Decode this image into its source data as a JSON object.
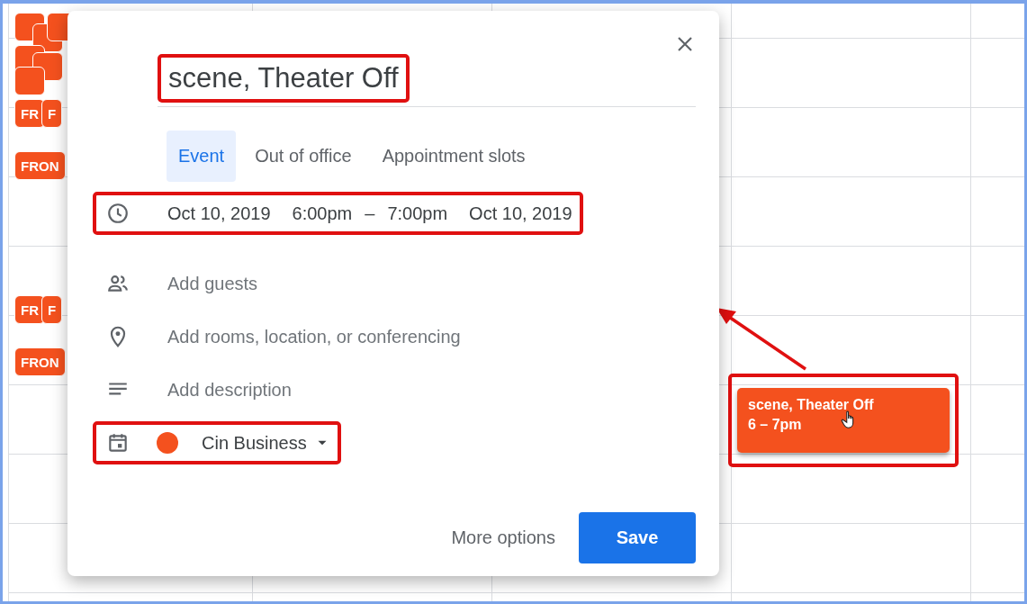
{
  "calendar": {
    "side_chips": [
      {
        "kind": "cluster"
      },
      {
        "kind": "row",
        "labels": [
          "FR",
          "F"
        ]
      },
      {
        "kind": "row",
        "labels": [
          "FRON"
        ]
      },
      {
        "kind": "gap"
      },
      {
        "kind": "row",
        "labels": [
          "FR",
          "F"
        ]
      },
      {
        "kind": "row",
        "labels": [
          "FRON"
        ]
      }
    ],
    "event_chip": {
      "title": "scene, Theater Off",
      "time": "6 – 7pm",
      "color": "#f4511e",
      "highlighted": true
    }
  },
  "dialog": {
    "title": {
      "value": "scene, Theater Off",
      "highlighted": true
    },
    "tabs": [
      {
        "label": "Event",
        "selected": true
      },
      {
        "label": "Out of office",
        "selected": false
      },
      {
        "label": "Appointment slots",
        "selected": false
      }
    ],
    "rows": [
      {
        "kind": "datetime",
        "highlighted": true,
        "parts": [
          "Oct 10, 2019",
          "6:00pm",
          "–",
          "7:00pm",
          "Oct 10, 2019"
        ]
      },
      {
        "kind": "guests",
        "highlighted": false,
        "placeholder": "Add guests"
      },
      {
        "kind": "location",
        "highlighted": false,
        "placeholder": "Add rooms, location, or conferencing"
      },
      {
        "kind": "description",
        "highlighted": false,
        "placeholder": "Add description"
      },
      {
        "kind": "calendar",
        "highlighted": true,
        "calendar": "Cin Business",
        "color": "#f4511e"
      }
    ],
    "buttons": [
      {
        "label": "More options",
        "kind": "text"
      },
      {
        "label": "Save",
        "kind": "primary"
      }
    ]
  }
}
